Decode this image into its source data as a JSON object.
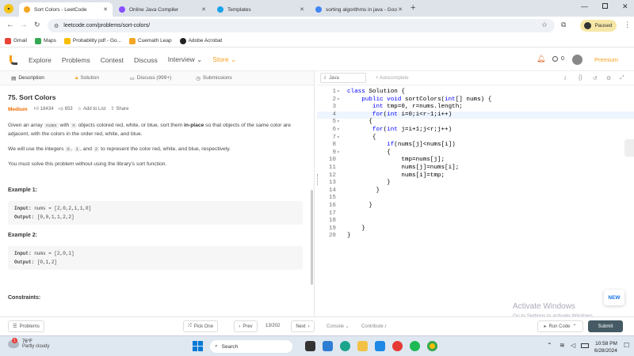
{
  "browser": {
    "tabs": [
      {
        "label": "Sort Colors - LeetCode",
        "color": "#f5a623",
        "active": true
      },
      {
        "label": "Online Java Compiler",
        "color": "#8a4fff",
        "active": false
      },
      {
        "label": "Templates",
        "color": "#1ba3e8",
        "active": false
      },
      {
        "label": "sorting algorithms in java - Goo",
        "color": "#4285f4",
        "active": false
      }
    ],
    "url": "leetcode.com/problems/sort-colors/",
    "paused_label": "Paused",
    "bookmarks": [
      {
        "label": "Gmail",
        "color": "#ea4335"
      },
      {
        "label": "Maps",
        "color": "#34a853"
      },
      {
        "label": "Probability pdf - Go...",
        "color": "#fbbc04"
      },
      {
        "label": "Cuemath Leap",
        "color": "#f5a623"
      },
      {
        "label": "Adobe Acrobat",
        "color": "#222222"
      }
    ]
  },
  "lc_nav": {
    "items": [
      "Explore",
      "Problems",
      "Contest",
      "Discuss",
      "Interview ⌄"
    ],
    "store": "Store ⌄",
    "notif_count": "0",
    "premium": "Premium"
  },
  "left_tabs": [
    "Description",
    "Solution",
    "Discuss (999+)",
    "Submissions"
  ],
  "problem": {
    "title": "75. Sort Colors",
    "difficulty": "Medium",
    "likes": "18434",
    "dislikes": "653",
    "add_to_list": "Add to List",
    "share": "Share",
    "p1_a": "Given an array ",
    "p1_nums": "nums",
    "p1_b": " with ",
    "p1_n": "n",
    "p1_c": " objects colored red, white, or blue, sort them ",
    "p1_inplace": "in-place",
    "p1_d": " so that objects of the same color are adjacent, with the colors in the order red, white, and blue.",
    "p2_a": "We will use the integers ",
    "p2_0": "0",
    "p2_comma": ", ",
    "p2_1": "1",
    "p2_and": ", and ",
    "p2_2": "2",
    "p2_b": " to represent the color red, white, and blue, respectively.",
    "p3": "You must solve this problem without using the library's sort function.",
    "example1_title": "Example 1:",
    "example1_input": "nums = [2,0,2,1,1,0]",
    "example1_output": "[0,0,1,1,2,2]",
    "example2_title": "Example 2:",
    "example2_input": "nums = [2,0,1]",
    "example2_output": "[0,1,2]",
    "input_label": "Input:",
    "output_label": "Output:",
    "constraints_title": "Constraints:"
  },
  "editor": {
    "language": "Java",
    "autocomplete": "Autocomplete",
    "lines": [
      "class Solution {",
      "    public void sortColors(int[] nums) {",
      "       int tmp=0, r=nums.length;",
      "       for(int i=0;i<r-1;i++)",
      "      {",
      "       for(int j=i+1;j<r;j++)",
      "       {",
      "           if(nums[j]<nums[i])",
      "           {",
      "               tmp=nums[j];",
      "               nums[j]=nums[i];",
      "               nums[i]=tmp;",
      "           }",
      "        }",
      "",
      "      }",
      "",
      "",
      "    }",
      "}"
    ],
    "line_numbers": [
      "1",
      "2",
      "3",
      "4",
      "5",
      "6",
      "7",
      "8",
      "9",
      "10",
      "11",
      "12",
      "13",
      "14",
      "15",
      "16",
      "17",
      "18",
      "19",
      "20"
    ]
  },
  "watermark": {
    "title": "Activate Windows",
    "sub": "Go to Settings to activate Windows."
  },
  "new_badge": "NEW",
  "bottom": {
    "problems": "Problems",
    "pick_one": "Pick One",
    "prev": "Prev",
    "page": "13/202",
    "next": "Next",
    "console": "Console",
    "contribute": "Contribute",
    "run_code": "Run Code",
    "submit": "Submit"
  },
  "taskbar": {
    "temp": "76°F",
    "weather": "Partly cloudy",
    "search": "Search",
    "time": "10:58 PM",
    "date": "6/28/2024"
  }
}
